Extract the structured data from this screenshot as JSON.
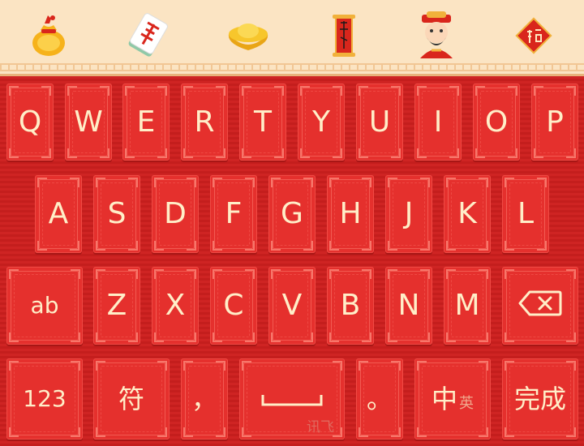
{
  "toolbar": {
    "icons": [
      "money-bag-icon",
      "mahjong-tile-icon",
      "gold-ingot-icon",
      "red-scroll-icon",
      "god-of-wealth-icon",
      "fu-diamond-icon"
    ]
  },
  "keyboard": {
    "row1": [
      "Q",
      "W",
      "E",
      "R",
      "T",
      "Y",
      "U",
      "I",
      "O",
      "P"
    ],
    "row2": [
      "A",
      "S",
      "D",
      "F",
      "G",
      "H",
      "J",
      "K",
      "L"
    ],
    "row3": [
      "Z",
      "X",
      "C",
      "V",
      "B",
      "N",
      "M"
    ],
    "shift_label": "ab",
    "numbers_label": "123",
    "symbols_label": "符",
    "comma_label": "，",
    "period_label": "。",
    "lang_primary": "中",
    "lang_secondary": "英",
    "done_label": "完成",
    "brand_watermark": "讯飞"
  },
  "colors": {
    "key_face": "#e5302d",
    "key_text": "#ffeec8",
    "board_bg": "#c8201f",
    "topbar_bg": "#fbe4c3"
  }
}
